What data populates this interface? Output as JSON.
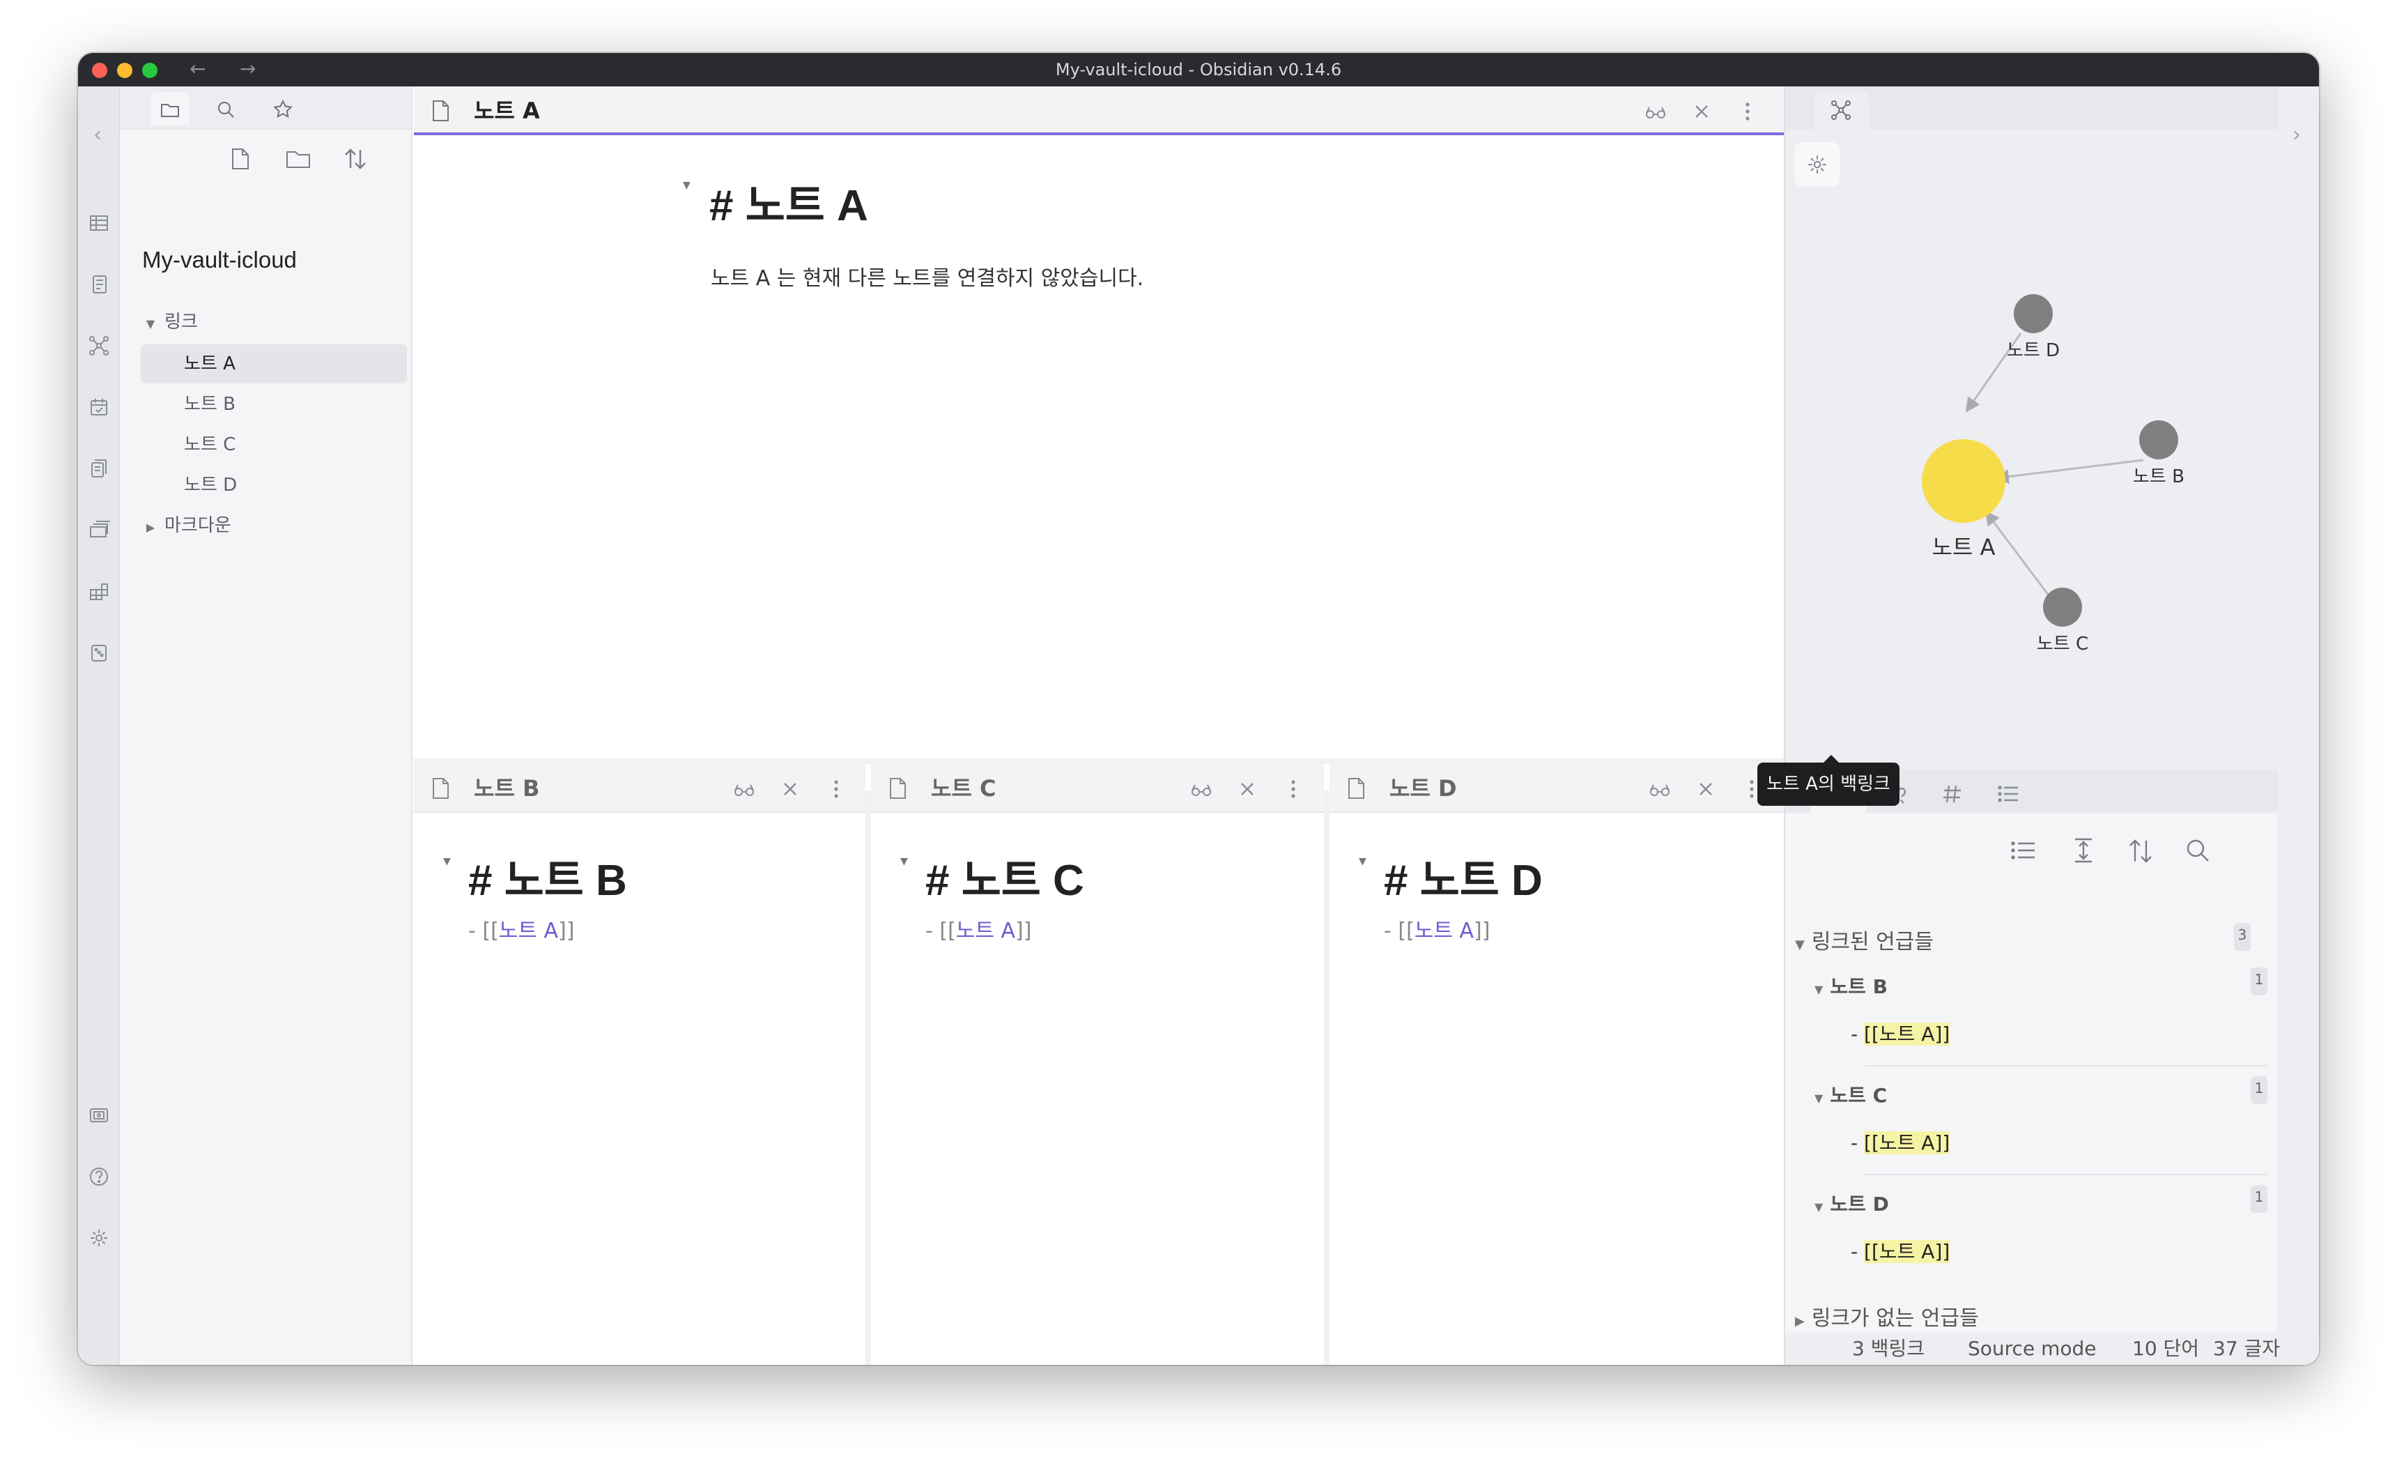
{
  "window": {
    "title": "My-vault-icloud - Obsidian v0.14.6",
    "back": "←",
    "forward": "→"
  },
  "file_explorer": {
    "vault_name": "My-vault-icloud",
    "folders": [
      {
        "name": "링크",
        "expanded": true,
        "files": [
          "노트 A",
          "노트 B",
          "노트 C",
          "노트 D"
        ]
      },
      {
        "name": "마크다운",
        "expanded": false
      }
    ],
    "selected": "노트 A"
  },
  "panes": {
    "a": {
      "title": "노트 A",
      "heading": "# 노트 A",
      "body": "노트 A 는 현재 다른 노트를 연결하지 않았습니다."
    },
    "b": {
      "title": "노트 B",
      "heading": "# 노트 B",
      "prefix": "- [[",
      "link": "노트 A",
      "suffix": "]]"
    },
    "c": {
      "title": "노트 C",
      "heading": "# 노트 C",
      "prefix": "- [[",
      "link": "노트 A",
      "suffix": "]]"
    },
    "d": {
      "title": "노트 D",
      "heading": "# 노트 D",
      "prefix": "- [[",
      "link": "노트 A",
      "suffix": "]]"
    }
  },
  "graph": {
    "nodes": [
      {
        "label": "노트 D"
      },
      {
        "label": "노트 B"
      },
      {
        "label": "노트 A",
        "active": true
      },
      {
        "label": "노트 C"
      }
    ],
    "active_color": "#f7dc4a",
    "node_color": "#808080"
  },
  "backlinks": {
    "tooltip": "노트 A의 백링크",
    "linked_title": "링크된 언급들",
    "linked_count": "3",
    "groups": [
      {
        "name": "노트 B",
        "count": "1",
        "snippet_prefix": "- ",
        "snippet": "[[노트 A]]"
      },
      {
        "name": "노트 C",
        "count": "1",
        "snippet_prefix": "- ",
        "snippet": "[[노트 A]]"
      },
      {
        "name": "노트 D",
        "count": "1",
        "snippet_prefix": "- ",
        "snippet": "[[노트 A]]"
      }
    ],
    "unlinked_title": "링크가 없는 언급들"
  },
  "status_bar": {
    "backlinks": "3 백링크",
    "mode": "Source mode",
    "words": "10 단어",
    "chars": "37 글자"
  },
  "colors": {
    "accent": "#7b6cd9",
    "link": "#6a5bd0",
    "highlight": "#f6f3a5"
  }
}
